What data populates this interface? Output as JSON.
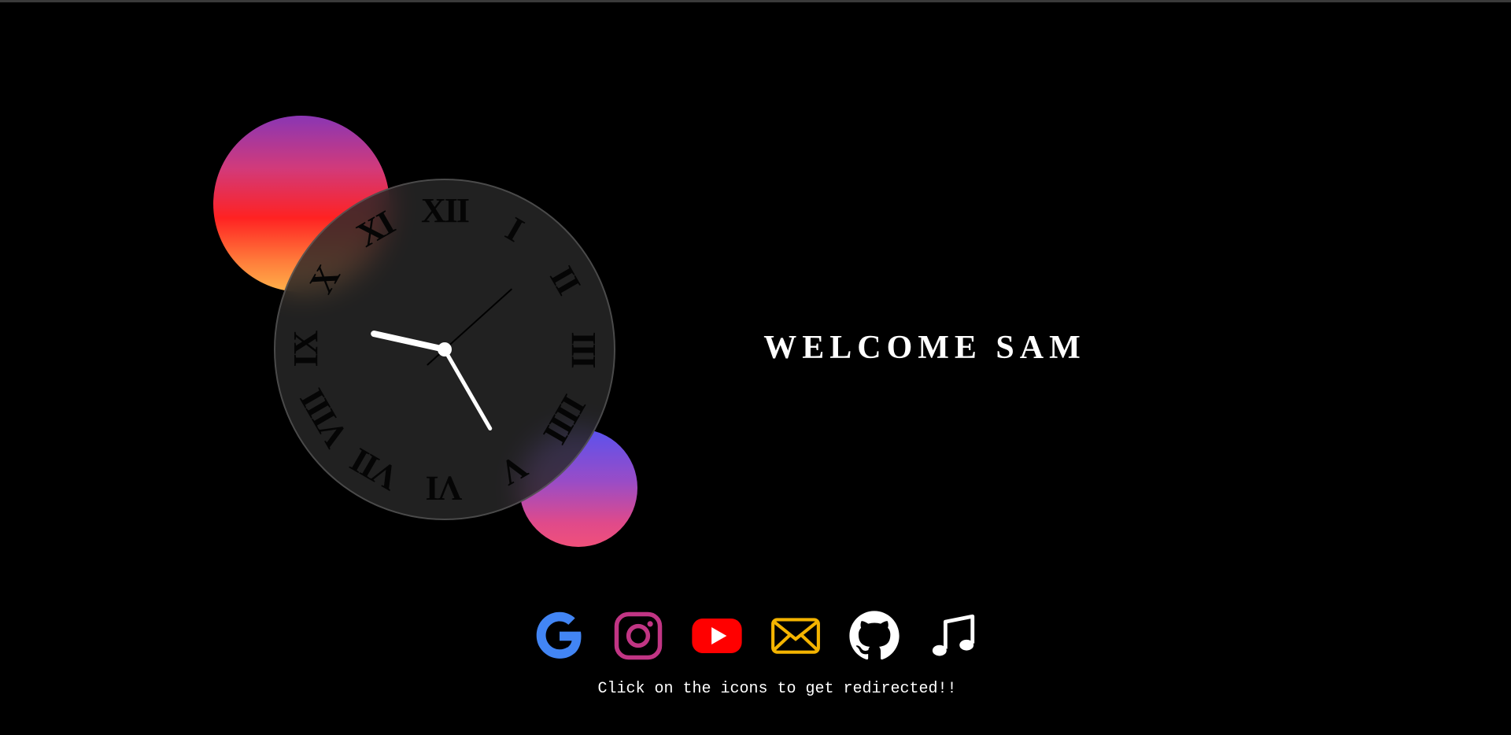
{
  "greeting": {
    "text": "WELCOME SAM"
  },
  "clock": {
    "numerals": [
      "XII",
      "I",
      "II",
      "III",
      "IIII",
      "V",
      "VI",
      "VII",
      "VIII",
      "IX",
      "X",
      "XI"
    ],
    "time": {
      "hours": 9,
      "minutes": 25,
      "seconds": 38
    }
  },
  "links": [
    {
      "name": "google",
      "icon": "google-icon",
      "color": "#4285F4"
    },
    {
      "name": "instagram",
      "icon": "instagram-icon",
      "color": "#C13584"
    },
    {
      "name": "youtube",
      "icon": "youtube-icon",
      "color": "#FF0000"
    },
    {
      "name": "mail",
      "icon": "mail-icon",
      "color": "#F4B400"
    },
    {
      "name": "github",
      "icon": "github-icon",
      "color": "#FFFFFF"
    },
    {
      "name": "music",
      "icon": "music-note-icon",
      "color": "#FFFFFF"
    }
  ],
  "hint": {
    "text": "Click on the icons to get redirected!!"
  },
  "colors": {
    "background": "#000000",
    "text": "#FFFFFF"
  }
}
